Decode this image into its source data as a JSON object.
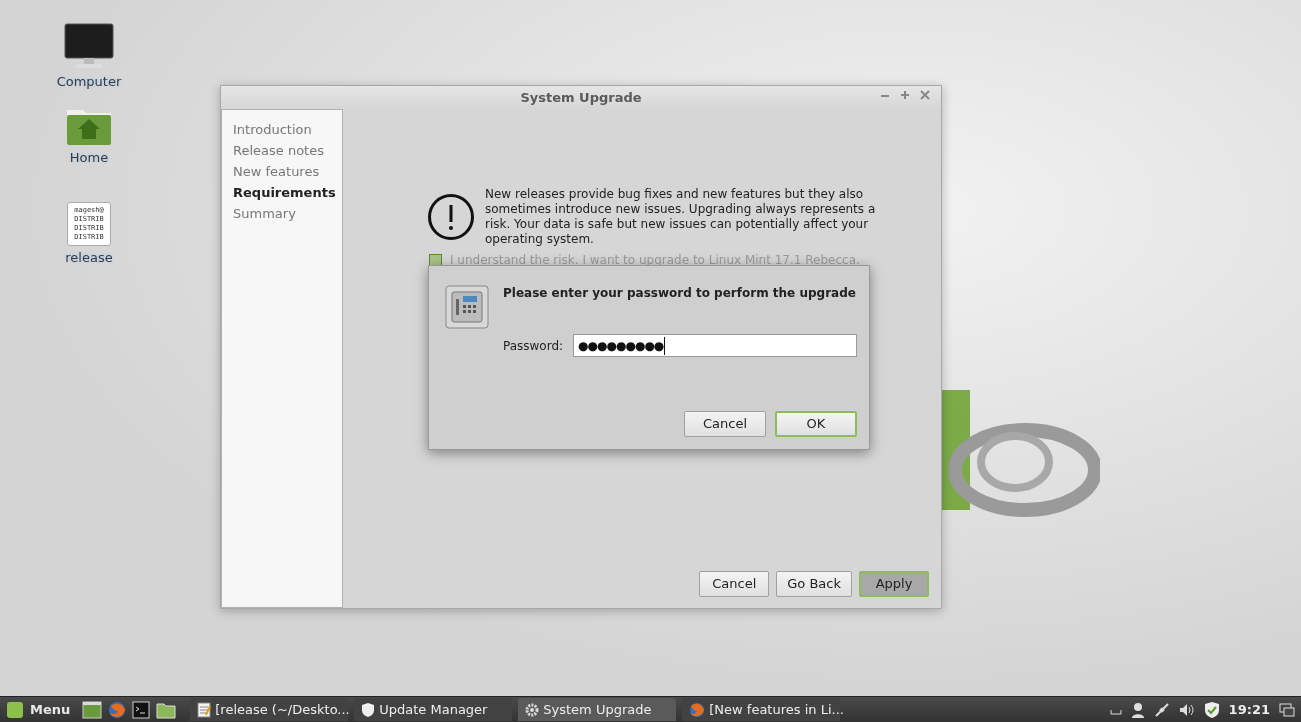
{
  "desktop_icons": [
    {
      "kind": "monitor",
      "label": "Computer"
    },
    {
      "kind": "home",
      "label": "Home"
    },
    {
      "kind": "file",
      "label": "release",
      "file_lines": [
        "magesh@",
        "DISTRIB",
        "DISTRIB",
        "DISTRIB"
      ]
    }
  ],
  "window": {
    "title": "System Upgrade",
    "sidebar": {
      "items": [
        {
          "label": "Introduction",
          "selected": false
        },
        {
          "label": "Release notes",
          "selected": false
        },
        {
          "label": "New features",
          "selected": false
        },
        {
          "label": "Requirements",
          "selected": true
        },
        {
          "label": "Summary",
          "selected": false
        }
      ]
    },
    "warning_text": "New releases provide bug fixes and new features but they also sometimes introduce new issues. Upgrading always represents a risk. Your data is safe but new issues can potentially affect your operating system.",
    "checkbox": {
      "label": "I understand the risk. I want to upgrade to Linux Mint 17.1 Rebecca.",
      "checked": false
    },
    "buttons": [
      {
        "label": "Cancel",
        "focused": false
      },
      {
        "label": "Go Back",
        "focused": false
      },
      {
        "label": "Apply",
        "focused": true
      }
    ]
  },
  "password_dialog": {
    "message": "Please enter your password to perform the upgrade",
    "field_label": "Password:",
    "value": "●●●●●●●●●",
    "buttons": [
      {
        "label": "Cancel",
        "focused": false
      },
      {
        "label": "OK",
        "focused": true
      }
    ]
  },
  "taskbar": {
    "menu_label": "Menu",
    "launchers": [
      {
        "kind": "desktop"
      },
      {
        "kind": "browser"
      },
      {
        "kind": "terminal"
      },
      {
        "kind": "folder"
      }
    ],
    "windows": [
      {
        "kind": "editor",
        "label": "[release (~/Deskto...",
        "selected": false
      },
      {
        "kind": "shield",
        "label": "Update Manager",
        "selected": false
      },
      {
        "kind": "gear",
        "label": "System Upgrade",
        "selected": true
      },
      {
        "kind": "browser",
        "label": "[New features in Li...",
        "selected": false
      }
    ],
    "clock": "19:21"
  }
}
